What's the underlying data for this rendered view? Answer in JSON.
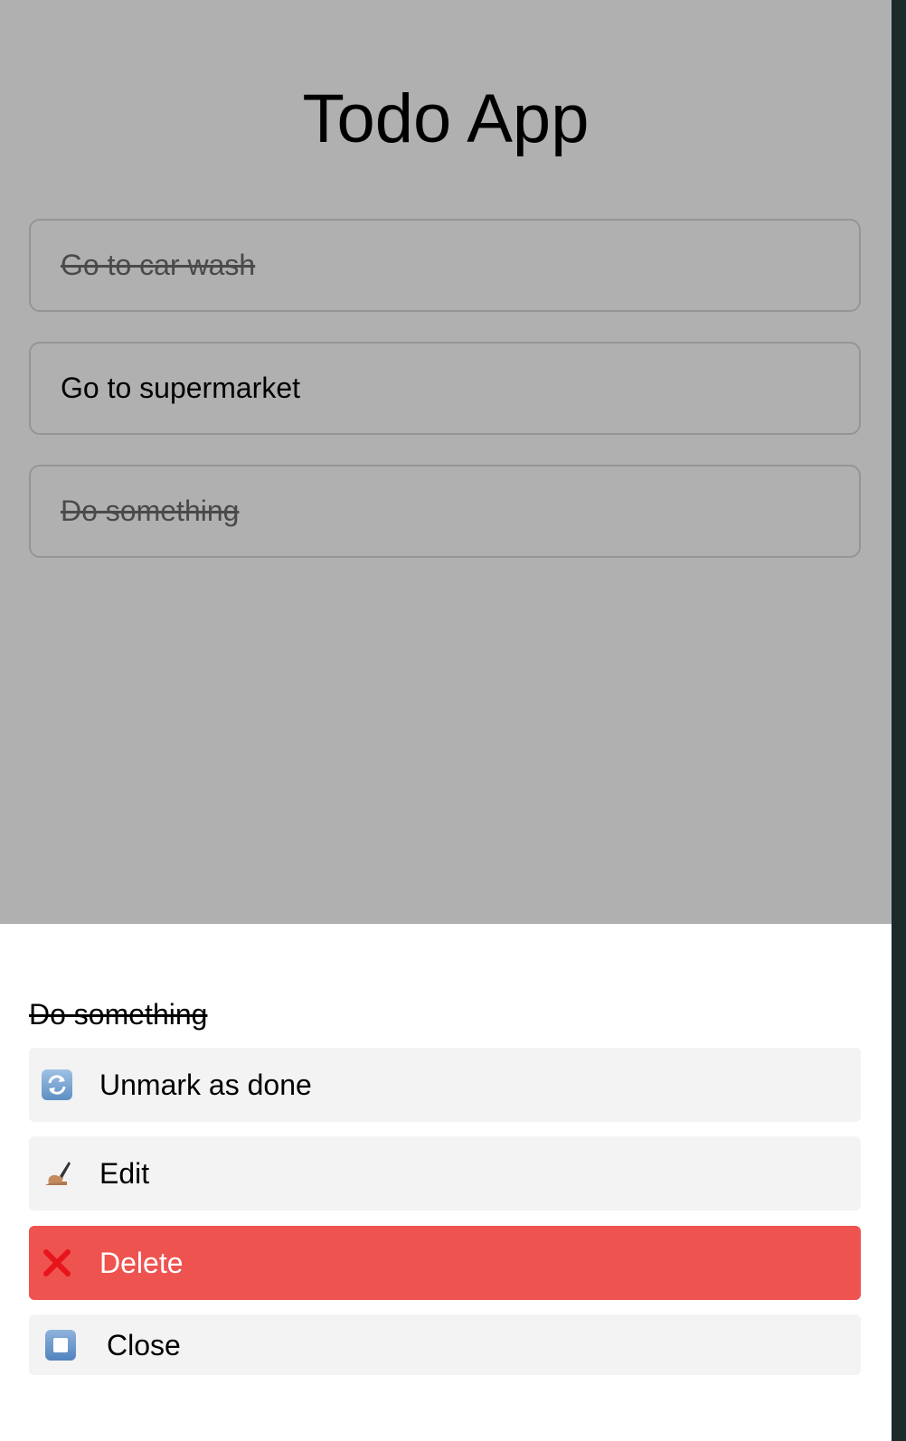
{
  "app": {
    "title": "Todo App"
  },
  "todos": [
    {
      "text": "Go to car wash",
      "done": true
    },
    {
      "text": "Go to supermarket",
      "done": false
    },
    {
      "text": "Do something",
      "done": true
    }
  ],
  "sheet": {
    "title": "Do something",
    "actions": [
      {
        "label": "Unmark as done",
        "icon": "refresh-icon"
      },
      {
        "label": "Edit",
        "icon": "writing-hand-icon"
      },
      {
        "label": "Delete",
        "icon": "cross-mark-icon"
      },
      {
        "label": "Close",
        "icon": "stop-button-icon"
      }
    ]
  },
  "colors": {
    "delete_background": "#ee5350",
    "action_background": "#f3f3f3",
    "cross_icon": "#e8141b"
  }
}
